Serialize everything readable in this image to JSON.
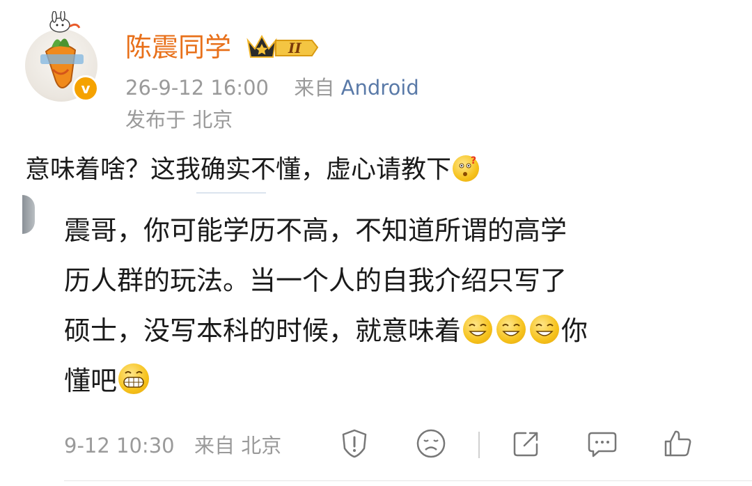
{
  "post": {
    "username": "陈震同学",
    "level_badge": "II",
    "verified_badge": "v",
    "time": "26-9-12 16:00",
    "from_prefix": "来自",
    "source": "Android",
    "location": "发布于 北京",
    "text": "意味着啥？这我确实不懂，虚心请教下",
    "text_emoji": "thinking-face-emoji"
  },
  "comment": {
    "line1": "震哥，你可能学历不高，不知道所谓的高学",
    "line2": "历人群的玩法。当一个人的自我介绍只写了",
    "line3_before": "硕士，没写本科的时候，就意味着",
    "line3_after": "你",
    "line4": "懂吧",
    "emojis": [
      "grin-emoji",
      "grin-emoji",
      "grin-emoji",
      "big-grin-emoji"
    ],
    "footer_time": "9-12 10:30",
    "footer_from": "来自 北京"
  },
  "colors": {
    "username": "#e8701a",
    "meta": "#9a9a9a",
    "source_link": "#5a7aa8",
    "verified": "#f5a200"
  },
  "icons": [
    "report-icon",
    "dislike-icon",
    "share-icon",
    "comment-icon",
    "like-icon"
  ]
}
